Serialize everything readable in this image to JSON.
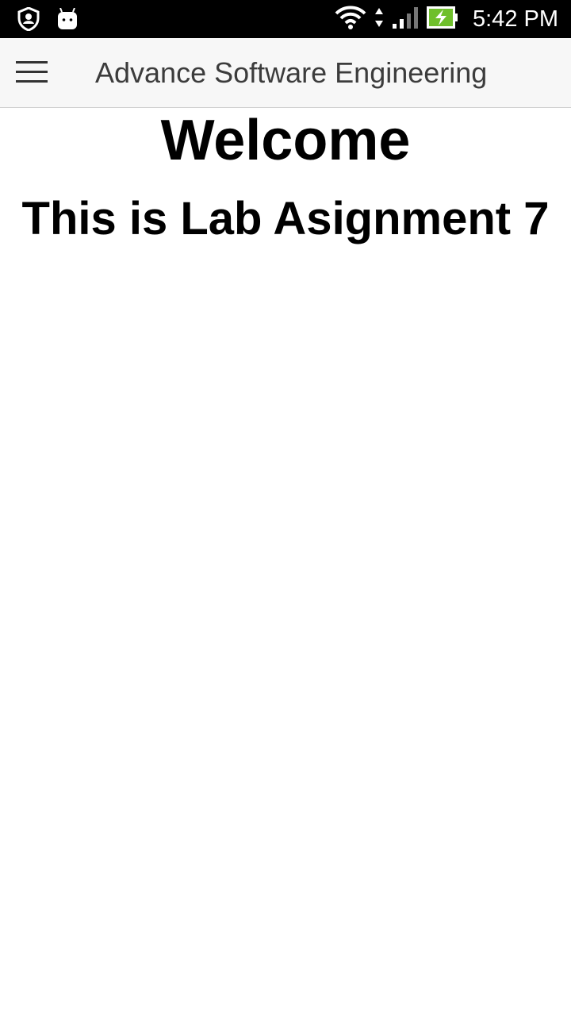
{
  "status_bar": {
    "time": "5:42 PM",
    "left_icons": [
      "shield-user-icon",
      "android-icon"
    ],
    "right_icons": [
      "wifi-icon",
      "data-arrows-icon",
      "signal-icon",
      "battery-charging-icon"
    ],
    "battery_color": "#6fbf2b"
  },
  "app_bar": {
    "title": "Advance Software Engineering",
    "menu_icon": "hamburger-menu-icon"
  },
  "main": {
    "heading": "Welcome",
    "subheading": "This is Lab Asignment 7"
  }
}
